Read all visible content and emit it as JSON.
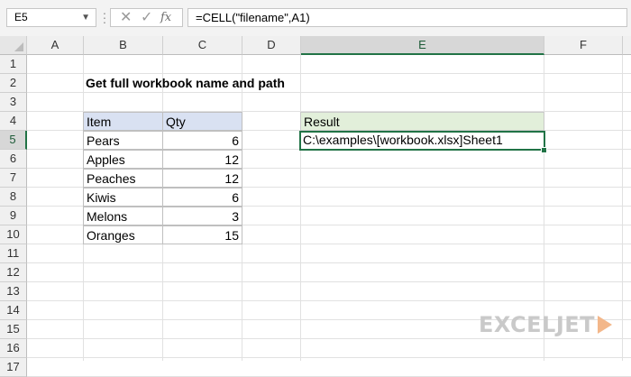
{
  "namebox": {
    "value": "E5",
    "dropdown_icon": "chevron-down-icon"
  },
  "formula_bar": {
    "cancel_icon": "x-icon",
    "enter_icon": "check-icon",
    "fx_label": "fx",
    "formula": "=CELL(\"filename\",A1)"
  },
  "columns": [
    "A",
    "B",
    "C",
    "D",
    "E",
    "F"
  ],
  "active_column": "E",
  "rows": [
    "1",
    "2",
    "3",
    "4",
    "5",
    "6",
    "7",
    "8",
    "9",
    "10",
    "11",
    "12",
    "13",
    "14",
    "15",
    "16",
    "17"
  ],
  "active_row": "5",
  "sheet": {
    "title": "Get full workbook name and path",
    "table": {
      "headers": [
        "Item",
        "Qty"
      ],
      "rows": [
        [
          "Pears",
          "6"
        ],
        [
          "Apples",
          "12"
        ],
        [
          "Peaches",
          "12"
        ],
        [
          "Kiwis",
          "6"
        ],
        [
          "Melons",
          "3"
        ],
        [
          "Oranges",
          "15"
        ]
      ]
    },
    "result_header": "Result",
    "result_value": "C:\\examples\\[workbook.xlsx]Sheet1"
  },
  "logo": {
    "text": "EXCELJET"
  },
  "colors": {
    "accent": "#217346",
    "table_header": "#d9e1f2",
    "result_header": "#e2efda"
  }
}
